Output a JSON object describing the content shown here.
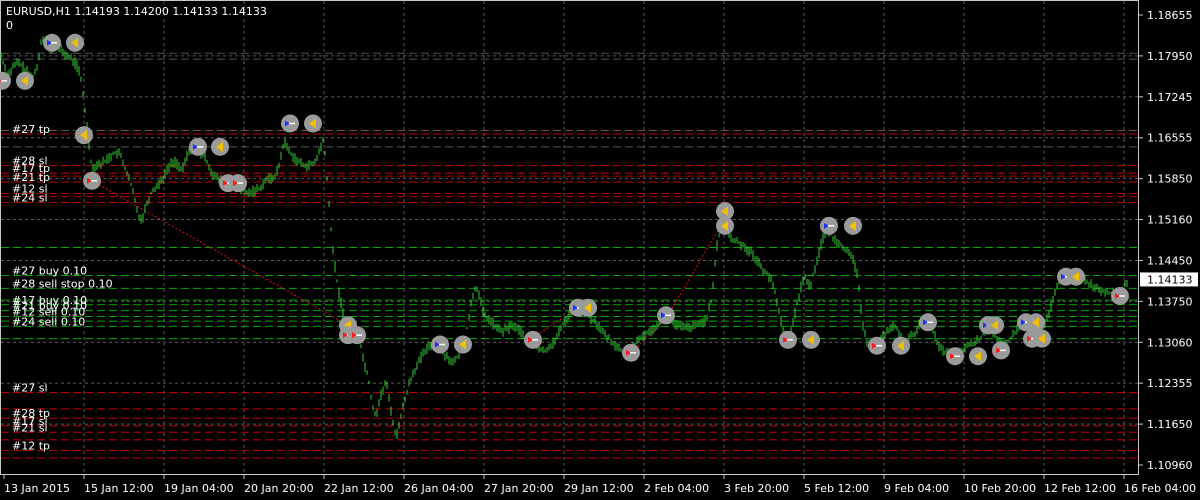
{
  "chart_data": {
    "type": "candlestick",
    "title": "EURUSD,H1  1.14193 1.14200 1.14133 1.14133",
    "indicator_value": "0",
    "y_ticks": [
      "1.18655",
      "1.17950",
      "1.17245",
      "1.16555",
      "1.15850",
      "1.15160",
      "1.14450",
      "1.13750",
      "1.13060",
      "1.12355",
      "1.11650",
      "1.10960"
    ],
    "ylim": [
      1.1096,
      1.18655
    ],
    "x_ticks": [
      "13 Jan 2015",
      "15 Jan 12:00",
      "19 Jan 04:00",
      "20 Jan 20:00",
      "22 Jan 12:00",
      "26 Jan 04:00",
      "27 Jan 20:00",
      "29 Jan 12:00",
      "2 Feb 04:00",
      "3 Feb 20:00",
      "5 Feb 12:00",
      "9 Feb 04:00",
      "10 Feb 20:00",
      "12 Feb 12:00",
      "16 Feb 04:00"
    ],
    "current_price": "1.14133",
    "current_price_value": 1.14133,
    "price_trace": [
      [
        0,
        1.18
      ],
      [
        4,
        1.178
      ],
      [
        8,
        1.1762
      ],
      [
        13,
        1.1776
      ],
      [
        18,
        1.1785
      ],
      [
        22,
        1.1778
      ],
      [
        27,
        1.1768
      ],
      [
        32,
        1.1757
      ],
      [
        37,
        1.1775
      ],
      [
        42,
        1.183
      ],
      [
        46,
        1.1818
      ],
      [
        52,
        1.1805
      ],
      [
        58,
        1.1812
      ],
      [
        64,
        1.18
      ],
      [
        70,
        1.1792
      ],
      [
        76,
        1.1782
      ],
      [
        80,
        1.1765
      ],
      [
        84,
        1.1718
      ],
      [
        88,
        1.166
      ],
      [
        92,
        1.1602
      ],
      [
        96,
        1.161
      ],
      [
        102,
        1.1612
      ],
      [
        108,
        1.162
      ],
      [
        114,
        1.163
      ],
      [
        120,
        1.1628
      ],
      [
        126,
        1.16
      ],
      [
        132,
        1.157
      ],
      [
        138,
        1.1525
      ],
      [
        142,
        1.1515
      ],
      [
        146,
        1.154
      ],
      [
        152,
        1.1565
      ],
      [
        158,
        1.1575
      ],
      [
        164,
        1.159
      ],
      [
        170,
        1.161
      ],
      [
        176,
        1.1615
      ],
      [
        182,
        1.1598
      ],
      [
        188,
        1.163
      ],
      [
        194,
        1.164
      ],
      [
        200,
        1.1628
      ],
      [
        206,
        1.162
      ],
      [
        212,
        1.1595
      ],
      [
        218,
        1.1585
      ],
      [
        224,
        1.1578
      ],
      [
        230,
        1.1578
      ],
      [
        236,
        1.1572
      ],
      [
        242,
        1.1566
      ],
      [
        248,
        1.156
      ],
      [
        254,
        1.1565
      ],
      [
        260,
        1.157
      ],
      [
        266,
        1.1585
      ],
      [
        272,
        1.1585
      ],
      [
        278,
        1.16
      ],
      [
        284,
        1.165
      ],
      [
        290,
        1.163
      ],
      [
        296,
        1.1618
      ],
      [
        302,
        1.161
      ],
      [
        308,
        1.1608
      ],
      [
        314,
        1.161
      ],
      [
        320,
        1.1635
      ],
      [
        324,
        1.1655
      ],
      [
        328,
        1.156
      ],
      [
        332,
        1.148
      ],
      [
        336,
        1.142
      ],
      [
        340,
        1.138
      ],
      [
        344,
        1.135
      ],
      [
        348,
        1.1338
      ],
      [
        352,
        1.1332
      ],
      [
        356,
        1.133
      ],
      [
        360,
        1.131
      ],
      [
        364,
        1.127
      ],
      [
        368,
        1.125
      ],
      [
        372,
        1.12
      ],
      [
        376,
        1.118
      ],
      [
        380,
        1.121
      ],
      [
        386,
        1.124
      ],
      [
        392,
        1.118
      ],
      [
        396,
        1.114
      ],
      [
        400,
        1.1175
      ],
      [
        404,
        1.12
      ],
      [
        408,
        1.123
      ],
      [
        412,
        1.125
      ],
      [
        418,
        1.127
      ],
      [
        424,
        1.1288
      ],
      [
        430,
        1.13
      ],
      [
        436,
        1.1305
      ],
      [
        442,
        1.129
      ],
      [
        448,
        1.128
      ],
      [
        454,
        1.127
      ],
      [
        460,
        1.129
      ],
      [
        464,
        1.1302
      ],
      [
        468,
        1.134
      ],
      [
        472,
        1.138
      ],
      [
        476,
        1.1405
      ],
      [
        480,
        1.138
      ],
      [
        484,
        1.135
      ],
      [
        490,
        1.1345
      ],
      [
        496,
        1.133
      ],
      [
        502,
        1.1325
      ],
      [
        508,
        1.133
      ],
      [
        514,
        1.1335
      ],
      [
        520,
        1.1325
      ],
      [
        526,
        1.1312
      ],
      [
        532,
        1.1305
      ],
      [
        538,
        1.1295
      ],
      [
        544,
        1.129
      ],
      [
        550,
        1.13
      ],
      [
        556,
        1.131
      ],
      [
        562,
        1.1335
      ],
      [
        568,
        1.135
      ],
      [
        574,
        1.1368
      ],
      [
        580,
        1.1368
      ],
      [
        586,
        1.1358
      ],
      [
        592,
        1.1345
      ],
      [
        598,
        1.1335
      ],
      [
        604,
        1.132
      ],
      [
        610,
        1.131
      ],
      [
        616,
        1.13
      ],
      [
        622,
        1.129
      ],
      [
        628,
        1.129
      ],
      [
        634,
        1.13
      ],
      [
        640,
        1.131
      ],
      [
        646,
        1.1322
      ],
      [
        652,
        1.1325
      ],
      [
        658,
        1.134
      ],
      [
        664,
        1.1352
      ],
      [
        670,
        1.1342
      ],
      [
        676,
        1.1336
      ],
      [
        682,
        1.1332
      ],
      [
        688,
        1.133
      ],
      [
        694,
        1.1334
      ],
      [
        700,
        1.1338
      ],
      [
        706,
        1.1345
      ],
      [
        712,
        1.138
      ],
      [
        716,
        1.146
      ],
      [
        720,
        1.15
      ],
      [
        724,
        1.152
      ],
      [
        728,
        1.1495
      ],
      [
        732,
        1.148
      ],
      [
        738,
        1.1478
      ],
      [
        744,
        1.147
      ],
      [
        750,
        1.1462
      ],
      [
        756,
        1.1448
      ],
      [
        762,
        1.1432
      ],
      [
        768,
        1.1422
      ],
      [
        774,
        1.14
      ],
      [
        780,
        1.135
      ],
      [
        786,
        1.131
      ],
      [
        792,
        1.133
      ],
      [
        798,
        1.138
      ],
      [
        804,
        1.142
      ],
      [
        810,
        1.14
      ],
      [
        816,
        1.144
      ],
      [
        822,
        1.148
      ],
      [
        828,
        1.15
      ],
      [
        834,
        1.1482
      ],
      [
        840,
        1.1476
      ],
      [
        846,
        1.1462
      ],
      [
        852,
        1.145
      ],
      [
        858,
        1.142
      ],
      [
        862,
        1.134
      ],
      [
        866,
        1.131
      ],
      [
        872,
        1.13
      ],
      [
        878,
        1.13
      ],
      [
        884,
        1.1318
      ],
      [
        890,
        1.133
      ],
      [
        896,
        1.1332
      ],
      [
        902,
        1.1308
      ],
      [
        908,
        1.131
      ],
      [
        914,
        1.132
      ],
      [
        920,
        1.1338
      ],
      [
        926,
        1.134
      ],
      [
        932,
        1.133
      ],
      [
        938,
        1.13
      ],
      [
        944,
        1.129
      ],
      [
        950,
        1.1285
      ],
      [
        956,
        1.1282
      ],
      [
        962,
        1.1292
      ],
      [
        968,
        1.13
      ],
      [
        974,
        1.1305
      ],
      [
        980,
        1.131
      ],
      [
        986,
        1.133
      ],
      [
        992,
        1.1328
      ],
      [
        998,
        1.1305
      ],
      [
        1004,
        1.13
      ],
      [
        1010,
        1.131
      ],
      [
        1016,
        1.1325
      ],
      [
        1022,
        1.1338
      ],
      [
        1028,
        1.134
      ],
      [
        1034,
        1.133
      ],
      [
        1040,
        1.132
      ],
      [
        1046,
        1.134
      ],
      [
        1050,
        1.136
      ],
      [
        1054,
        1.139
      ],
      [
        1058,
        1.1402
      ],
      [
        1062,
        1.1418
      ],
      [
        1066,
        1.1422
      ],
      [
        1070,
        1.142
      ],
      [
        1074,
        1.1415
      ],
      [
        1078,
        1.142
      ],
      [
        1082,
        1.1418
      ],
      [
        1086,
        1.1412
      ],
      [
        1090,
        1.1405
      ],
      [
        1096,
        1.14
      ],
      [
        1102,
        1.1395
      ],
      [
        1108,
        1.1392
      ],
      [
        1114,
        1.1388
      ],
      [
        1118,
        1.1382
      ],
      [
        1122,
        1.1395
      ],
      [
        1128,
        1.1413
      ]
    ],
    "level_labels": [
      {
        "text": "#27 tp",
        "price": 1.1662
      },
      {
        "text": "#28 sl",
        "price": 1.1608
      },
      {
        "text": "#17 tp",
        "price": 1.1595
      },
      {
        "text": "#21 tp",
        "price": 1.158
      },
      {
        "text": "#12 sl",
        "price": 1.156
      },
      {
        "text": "#24 sl",
        "price": 1.1545
      },
      {
        "text": "#27 buy 0.10",
        "price": 1.142
      },
      {
        "text": "#28 sell stop 0.10",
        "price": 1.1398
      },
      {
        "text": "#17 buy 0.10",
        "price": 1.137
      },
      {
        "text": "#21 buy 0.10",
        "price": 1.136
      },
      {
        "text": "#12 sell 0.10",
        "price": 1.135
      },
      {
        "text": "#24 sell 0.10",
        "price": 1.1333
      },
      {
        "text": "#27 sl",
        "price": 1.122
      },
      {
        "text": "#28 tp",
        "price": 1.1176
      },
      {
        "text": "#17 sl",
        "price": 1.1163
      },
      {
        "text": "#21 sl",
        "price": 1.1152
      },
      {
        "text": "#12 tp",
        "price": 1.1121
      }
    ],
    "grey_lines": [
      1.18,
      1.179,
      1.1668,
      1.164
    ],
    "extra_dash_lines": [
      {
        "price": 1.159,
        "color": "#c00000"
      },
      {
        "price": 1.1555,
        "color": "#c00000"
      },
      {
        "price": 1.1468,
        "color": "#00aa00"
      },
      {
        "price": 1.1378,
        "color": "#00aa00"
      },
      {
        "price": 1.1342,
        "color": "#00aa00"
      },
      {
        "price": 1.1312,
        "color": "#00aa00"
      },
      {
        "price": 1.1192,
        "color": "#c00000"
      },
      {
        "price": 1.1139,
        "color": "#c00000"
      },
      {
        "price": 1.1108,
        "color": "#c00000"
      }
    ],
    "trade_lines": [
      [
        [
          92,
          1.1582
        ],
        [
          348,
          1.1335
        ]
      ],
      [
        [
          530,
          1.131
        ],
        [
          578,
          1.1365
        ]
      ],
      [
        [
          632,
          1.1288
        ],
        [
          668,
          1.1352
        ]
      ],
      [
        [
          668,
          1.1352
        ],
        [
          724,
          1.1515
        ]
      ]
    ],
    "markers": [
      {
        "x": 2,
        "price": 1.1753,
        "kind": "sell"
      },
      {
        "x": 25,
        "price": 1.1753,
        "kind": "close"
      },
      {
        "x": 52,
        "price": 1.1818,
        "kind": "buy"
      },
      {
        "x": 75,
        "price": 1.1818,
        "kind": "close"
      },
      {
        "x": 84,
        "price": 1.166,
        "kind": "close"
      },
      {
        "x": 92,
        "price": 1.1582,
        "kind": "sell"
      },
      {
        "x": 198,
        "price": 1.164,
        "kind": "buy"
      },
      {
        "x": 220,
        "price": 1.164,
        "kind": "close"
      },
      {
        "x": 228,
        "price": 1.1578,
        "kind": "sell"
      },
      {
        "x": 238,
        "price": 1.1578,
        "kind": "sell"
      },
      {
        "x": 290,
        "price": 1.168,
        "kind": "buy"
      },
      {
        "x": 313,
        "price": 1.168,
        "kind": "close"
      },
      {
        "x": 348,
        "price": 1.1335,
        "kind": "close"
      },
      {
        "x": 348,
        "price": 1.1318,
        "kind": "sell"
      },
      {
        "x": 357,
        "price": 1.1318,
        "kind": "sell"
      },
      {
        "x": 440,
        "price": 1.1302,
        "kind": "buy"
      },
      {
        "x": 463,
        "price": 1.1302,
        "kind": "close"
      },
      {
        "x": 533,
        "price": 1.131,
        "kind": "sell"
      },
      {
        "x": 578,
        "price": 1.1365,
        "kind": "buy"
      },
      {
        "x": 588,
        "price": 1.1365,
        "kind": "close"
      },
      {
        "x": 631,
        "price": 1.1288,
        "kind": "sell"
      },
      {
        "x": 666,
        "price": 1.1352,
        "kind": "buy"
      },
      {
        "x": 725,
        "price": 1.153,
        "kind": "close"
      },
      {
        "x": 725,
        "price": 1.1505,
        "kind": "close"
      },
      {
        "x": 788,
        "price": 1.131,
        "kind": "sell"
      },
      {
        "x": 811,
        "price": 1.131,
        "kind": "close"
      },
      {
        "x": 829,
        "price": 1.1505,
        "kind": "buy"
      },
      {
        "x": 853,
        "price": 1.1505,
        "kind": "close"
      },
      {
        "x": 877,
        "price": 1.13,
        "kind": "sell"
      },
      {
        "x": 901,
        "price": 1.13,
        "kind": "close"
      },
      {
        "x": 928,
        "price": 1.134,
        "kind": "buy"
      },
      {
        "x": 955,
        "price": 1.1282,
        "kind": "sell"
      },
      {
        "x": 978,
        "price": 1.1282,
        "kind": "close"
      },
      {
        "x": 988,
        "price": 1.1335,
        "kind": "buy"
      },
      {
        "x": 995,
        "price": 1.1335,
        "kind": "close"
      },
      {
        "x": 1001,
        "price": 1.1292,
        "kind": "sell"
      },
      {
        "x": 1026,
        "price": 1.134,
        "kind": "buy"
      },
      {
        "x": 1036,
        "price": 1.134,
        "kind": "close"
      },
      {
        "x": 1032,
        "price": 1.1312,
        "kind": "sell"
      },
      {
        "x": 1042,
        "price": 1.1312,
        "kind": "close"
      },
      {
        "x": 1066,
        "price": 1.1418,
        "kind": "buy"
      },
      {
        "x": 1076,
        "price": 1.1418,
        "kind": "close"
      },
      {
        "x": 1120,
        "price": 1.1385,
        "kind": "sell"
      }
    ]
  }
}
